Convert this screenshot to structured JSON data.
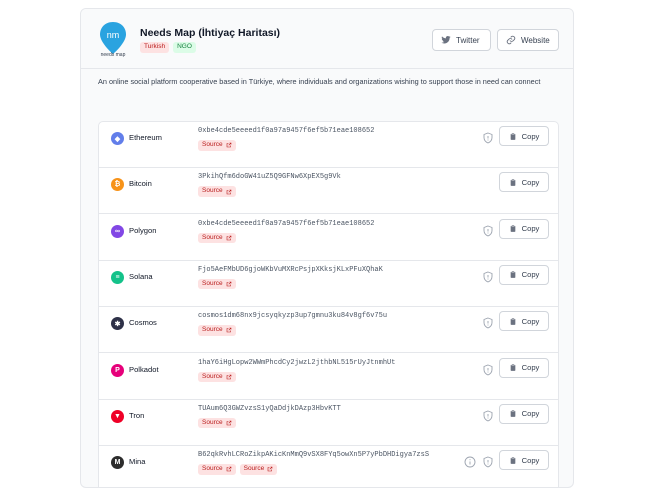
{
  "org": {
    "name": "Needs Map (İhtiyaç Haritası)",
    "logo_text": "nm",
    "logo_caption": "needs map",
    "tags": [
      "Turkish",
      "NGO"
    ],
    "description": "An online social platform cooperative based in Türkiye, where individuals and organizations wishing to support those in need can connect"
  },
  "header_buttons": {
    "twitter": "Twitter",
    "website": "Website"
  },
  "wallets": [
    {
      "coin": "Ethereum",
      "icon": "ethereum-icon",
      "color": "#627eea",
      "glyph": "◆",
      "address": "0xbe4cde5eeeed1f0a97a9457f6ef5b71eae108652",
      "sources": [
        "Source"
      ],
      "shield": true,
      "info": false,
      "copy": "Copy"
    },
    {
      "coin": "Bitcoin",
      "icon": "bitcoin-icon",
      "color": "#f7931a",
      "glyph": "₿",
      "address": "3PkihQfm6doGW41uZ5Q9GFNw6XpEX5g9Vk",
      "sources": [
        "Source"
      ],
      "shield": false,
      "info": false,
      "copy": "Copy"
    },
    {
      "coin": "Polygon",
      "icon": "polygon-icon",
      "color": "#8247e5",
      "glyph": "∞",
      "address": "0xbe4cde5eeeed1f0a97a9457f6ef5b71eae108652",
      "sources": [
        "Source"
      ],
      "shield": true,
      "info": false,
      "copy": "Copy"
    },
    {
      "coin": "Solana",
      "icon": "solana-icon",
      "color": "#14c28a",
      "glyph": "≡",
      "address": "Fjo5AeFMbUD6gjoWKbVuMXRcPsjpXKksjKLxPFuXQhaK",
      "sources": [
        "Source"
      ],
      "shield": true,
      "info": false,
      "copy": "Copy"
    },
    {
      "coin": "Cosmos",
      "icon": "cosmos-icon",
      "color": "#2e3148",
      "glyph": "✱",
      "address": "cosmos1dm68nx9jcsyqkyzp3up7gmnu3ku84v8gf6v75u",
      "sources": [
        "Source"
      ],
      "shield": true,
      "info": false,
      "copy": "Copy"
    },
    {
      "coin": "Polkadot",
      "icon": "polkadot-icon",
      "color": "#e6007a",
      "glyph": "P",
      "address": "1haY6iHgLopw2WWmPhcdCy2jwzL2jthbNL515rUyJtnmhUt",
      "sources": [
        "Source"
      ],
      "shield": true,
      "info": false,
      "copy": "Copy"
    },
    {
      "coin": "Tron",
      "icon": "tron-icon",
      "color": "#ef0027",
      "glyph": "▼",
      "address": "TUAum6Q3GWZvzsS1yQaDdjkDAzp3HbvKTT",
      "sources": [
        "Source"
      ],
      "shield": true,
      "info": false,
      "copy": "Copy"
    },
    {
      "coin": "Mina",
      "icon": "mina-icon",
      "color": "#2d2d2d",
      "glyph": "M",
      "address": "B62qkRvhLCRoZikpAKicKnMmQ9vSX8FYq5owXn5P7yPbDHDigya7zsS",
      "sources": [
        "Source",
        "Source"
      ],
      "shield": true,
      "info": true,
      "copy": "Copy"
    }
  ]
}
